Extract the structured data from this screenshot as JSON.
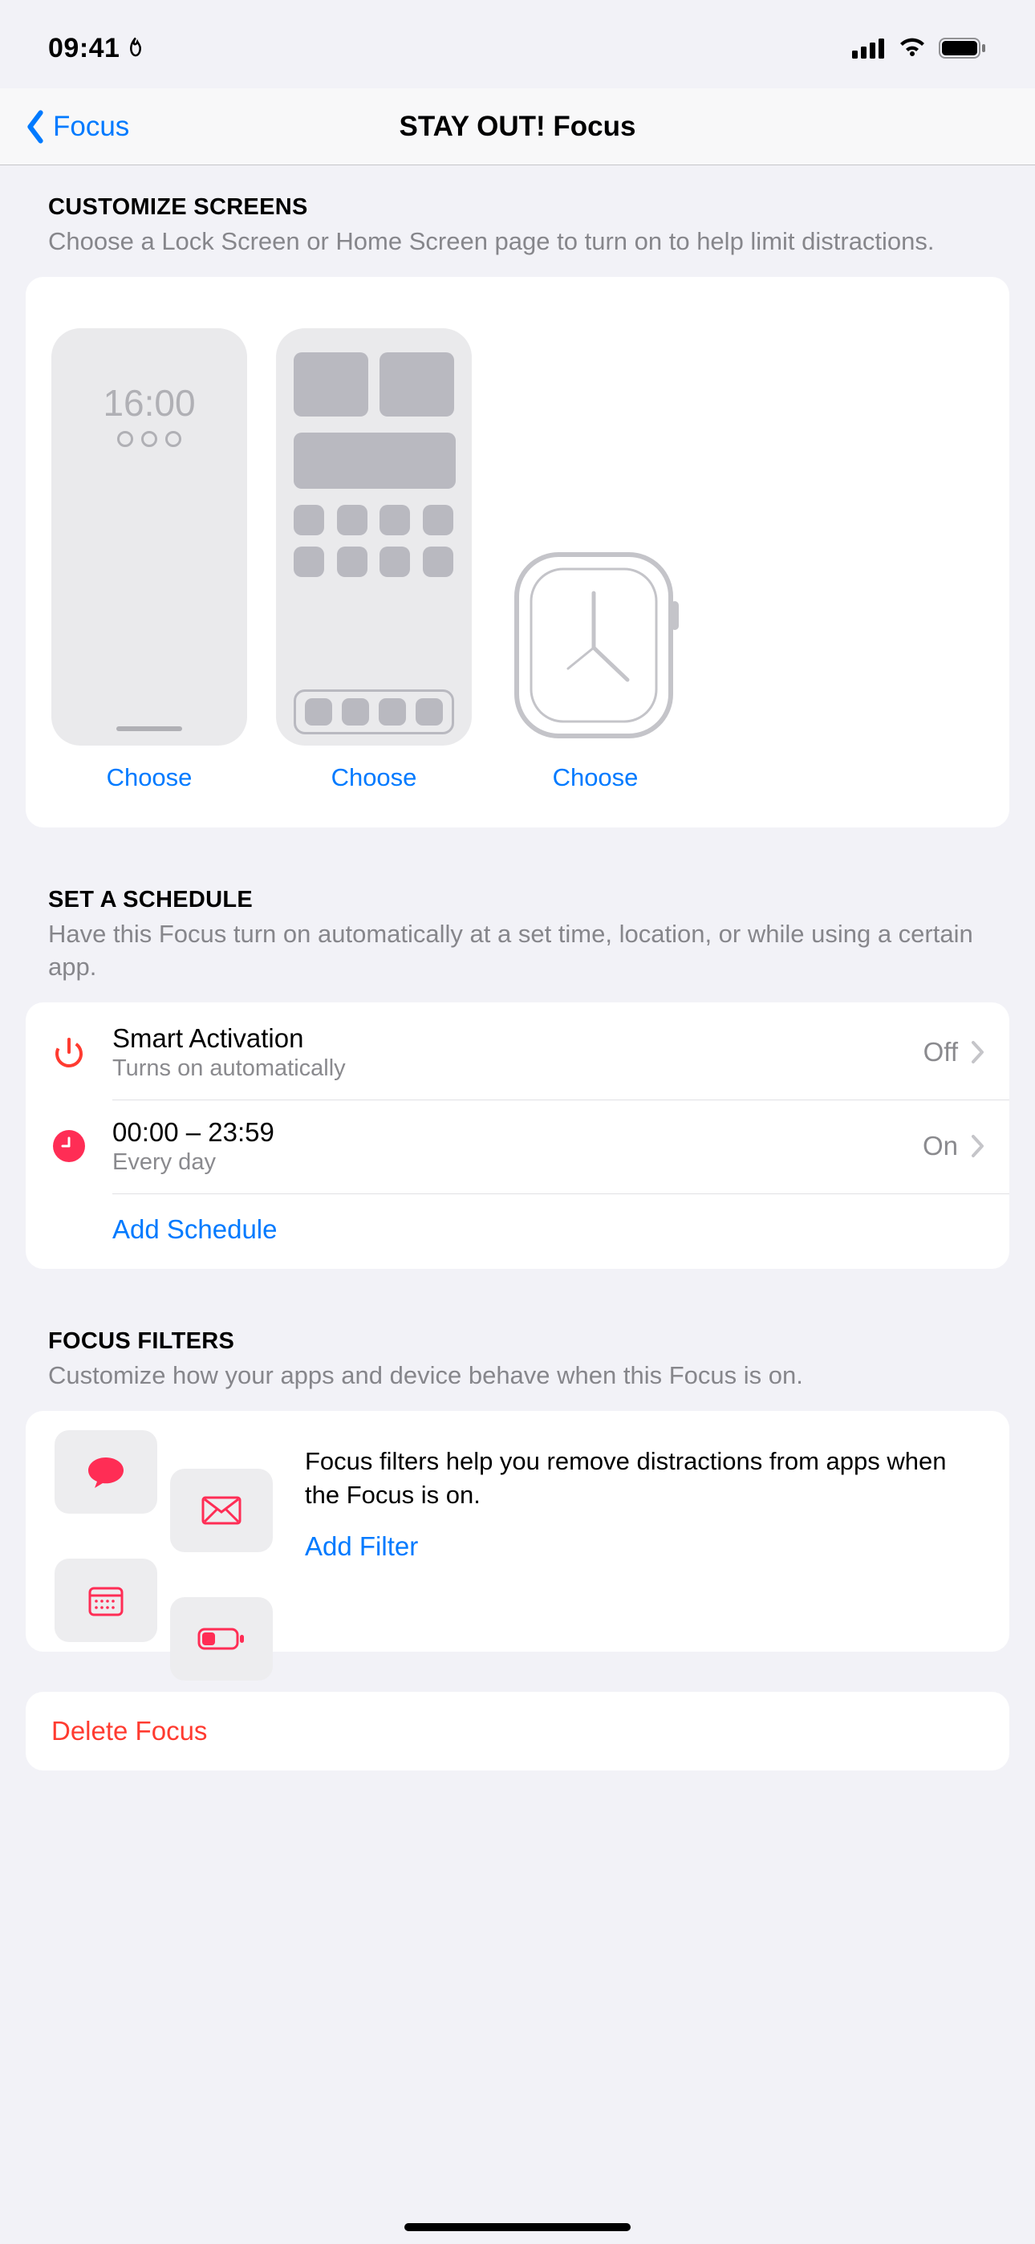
{
  "status_bar": {
    "time": "09:41"
  },
  "nav": {
    "back_label": "Focus",
    "title": "STAY OUT! Focus"
  },
  "sections": {
    "customize": {
      "title": "CUSTOMIZE SCREENS",
      "desc": "Choose a Lock Screen or Home Screen page to turn on to help limit distractions.",
      "lock_time": "16:00",
      "choose_label": "Choose"
    },
    "schedule": {
      "title": "SET A SCHEDULE",
      "desc": "Have this Focus turn on automatically at a set time, location, or while using a certain app.",
      "smart_activation": {
        "title": "Smart Activation",
        "subtitle": "Turns on automatically",
        "status": "Off"
      },
      "time_schedule": {
        "title": "00:00 – 23:59",
        "subtitle": "Every day",
        "status": "On"
      },
      "add_label": "Add Schedule"
    },
    "filters": {
      "title": "FOCUS FILTERS",
      "desc": "Customize how your apps and device behave when this Focus is on.",
      "help_text": "Focus filters help you remove distractions from apps when the Focus is on.",
      "add_label": "Add Filter"
    },
    "delete": {
      "label": "Delete Focus"
    }
  }
}
